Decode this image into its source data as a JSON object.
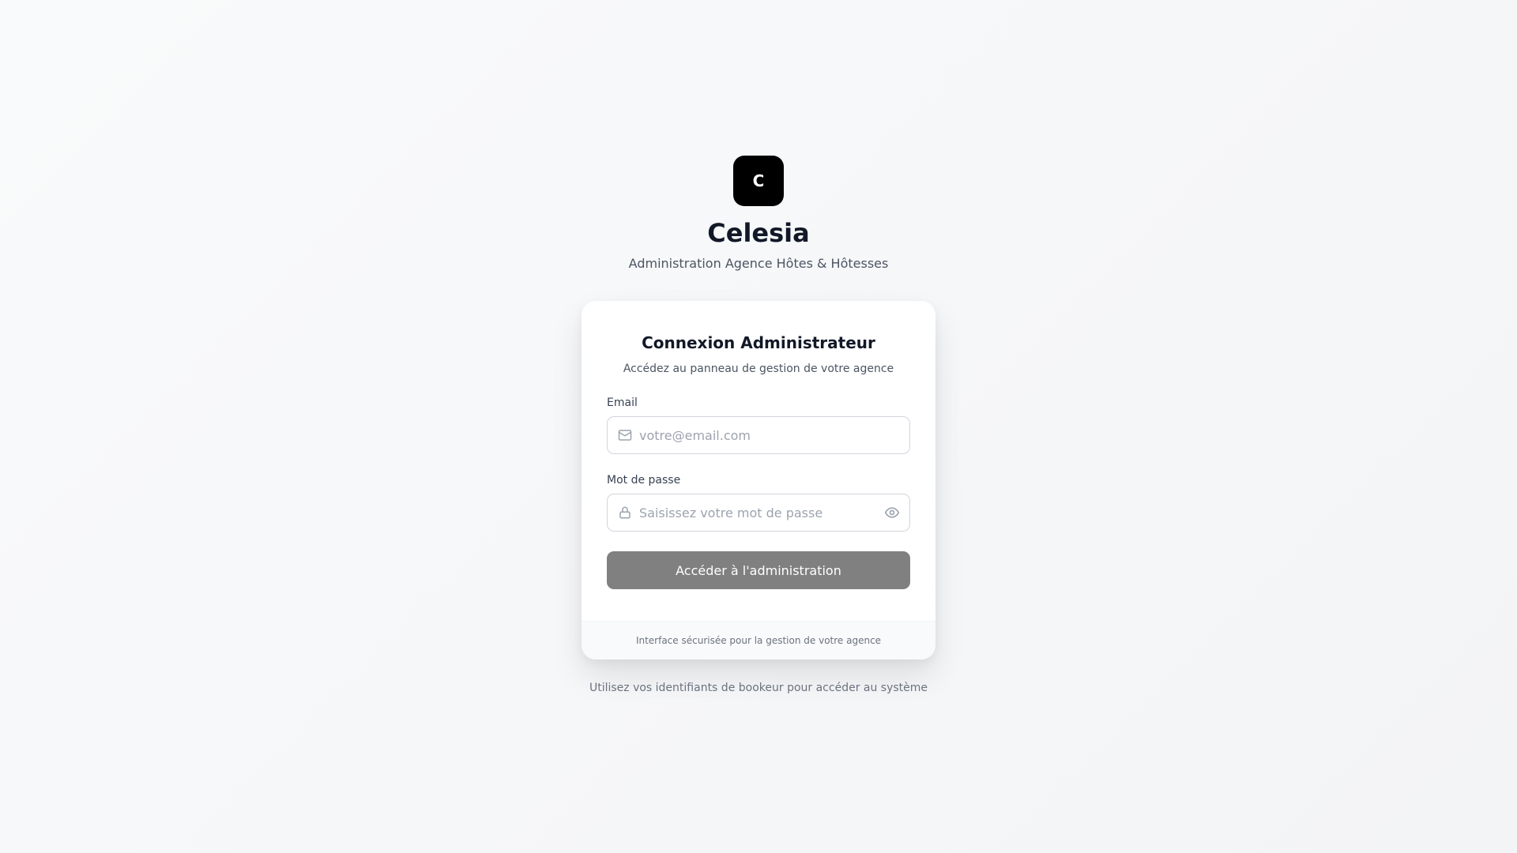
{
  "brand": {
    "logo_letter": "C",
    "name": "Celesia",
    "tagline": "Administration Agence Hôtes & Hôtesses"
  },
  "card": {
    "title": "Connexion Administrateur",
    "subtitle": "Accédez au panneau de gestion de votre agence",
    "email": {
      "label": "Email",
      "placeholder": "votre@email.com",
      "value": "",
      "icon": "mail-icon"
    },
    "password": {
      "label": "Mot de passe",
      "placeholder": "Saisissez votre mot de passe",
      "value": "",
      "icon": "lock-icon",
      "toggle_icon": "eye-icon"
    },
    "submit_label": "Accéder à l'administration",
    "footer": "Interface sécurisée pour la gestion de votre agence"
  },
  "help_text": "Utilisez vos identifiants de bookeur pour accéder au système",
  "colors": {
    "background": "#f9fafb",
    "logo_bg": "#000000",
    "button_bg": "#808080",
    "text_primary": "#111827",
    "text_muted": "#6b7280"
  }
}
